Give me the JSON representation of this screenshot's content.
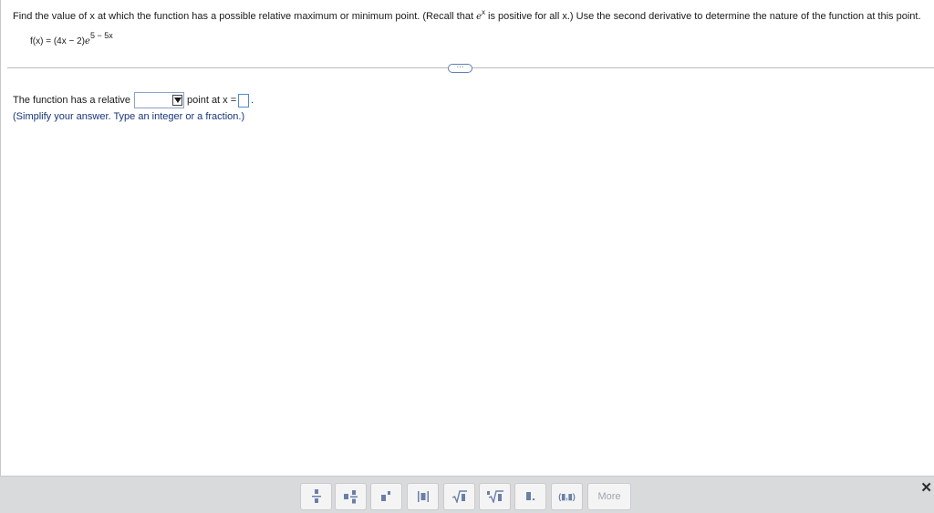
{
  "question": {
    "text_before": "Find the value of x at which the function has a possible relative maximum or minimum point. (Recall that ",
    "ex_base": "e",
    "ex_exp": "x",
    "text_after": " is positive for all x.) Use the second derivative to determine the nature of the function at this point."
  },
  "formula": {
    "lhs": "f(x) = (4x − 2)",
    "base": "e",
    "exponent": "5 − 5x"
  },
  "answer": {
    "prefix": "The function has a relative",
    "middle": "point at x =",
    "suffix": ".",
    "dropdown_value": "",
    "answer_value": ""
  },
  "hint": "(Simplify your answer. Type an integer or a fraction.)",
  "expander_label": "···",
  "toolbar": {
    "buttons": [
      "fraction-icon",
      "mixed-number-icon",
      "exponent-icon",
      "absolute-value-icon",
      "square-root-icon",
      "nth-root-icon",
      "decimal-icon",
      "ordered-pair-icon"
    ],
    "ordered_pair_label": "(▮,▮)",
    "more_label": "More",
    "close_label": "✕"
  },
  "colors": {
    "hint_text": "#17357a",
    "input_border": "#4d8ccf",
    "toolbar_bg": "#d9dadc",
    "toolbar_icon": "#6a7fa7"
  }
}
